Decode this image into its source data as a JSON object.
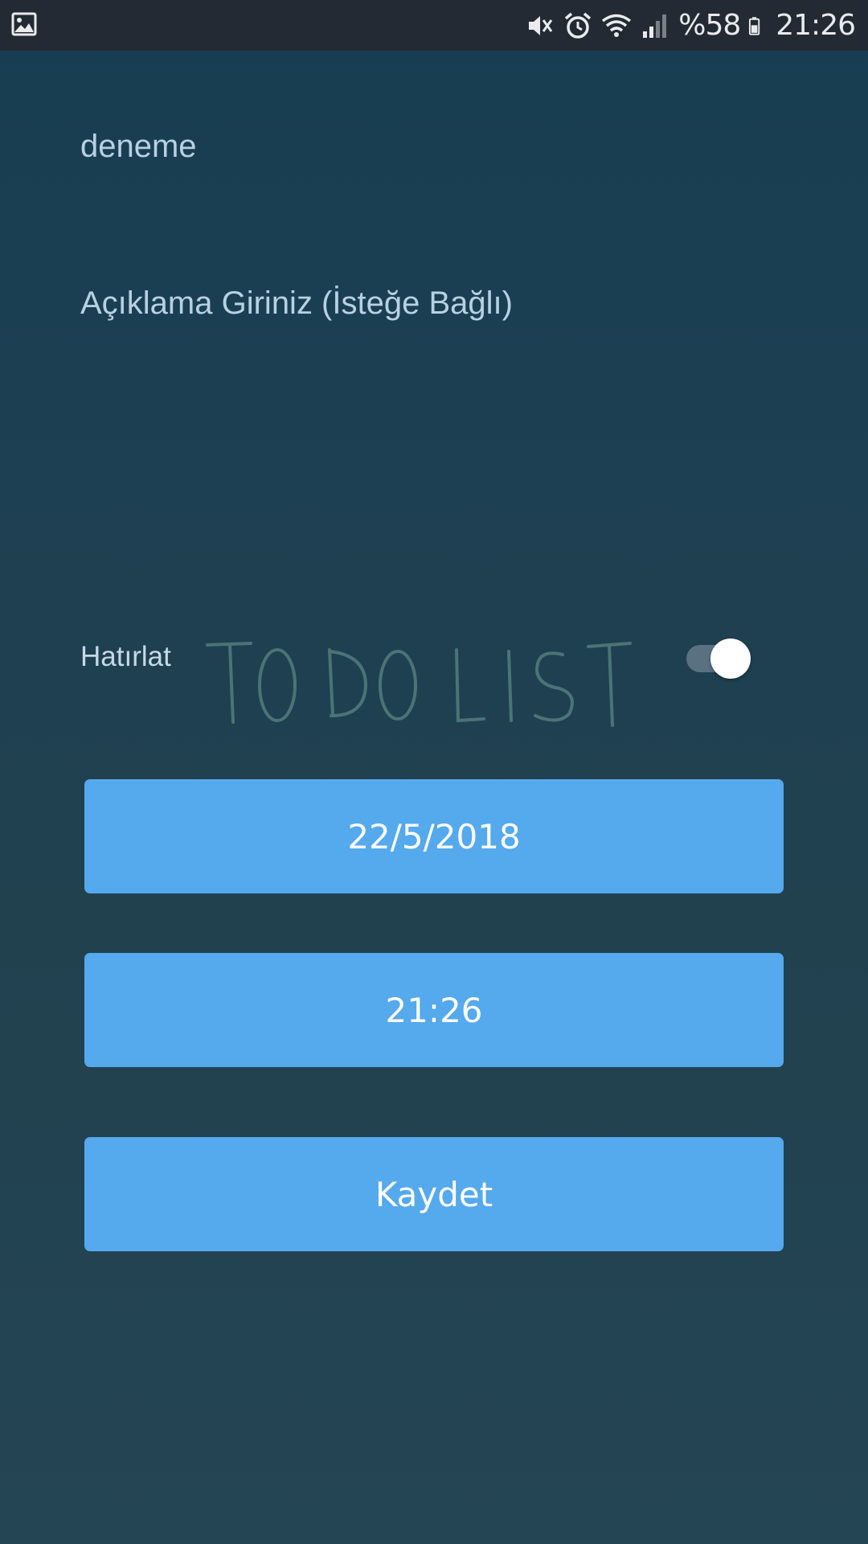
{
  "status_bar": {
    "battery_text": "%58",
    "time": "21:26",
    "icons": [
      "gallery-icon",
      "vibrate-mute-icon",
      "alarm-icon",
      "wifi-icon",
      "signal-icon",
      "battery-icon"
    ]
  },
  "form": {
    "title_value": "deneme",
    "description_placeholder": "Açıklama Giriniz (İsteğe Bağlı)",
    "remind_label": "Hatırlat",
    "remind_on": true,
    "logo_text": "TO DO LIST"
  },
  "buttons": {
    "date_label": "22/5/2018",
    "time_label": "21:26",
    "save_label": "Kaydet"
  },
  "colors": {
    "background": "#1d4052",
    "status_bar": "#242a33",
    "button": "#55a9ed",
    "label_text": "#b7d1e3"
  }
}
